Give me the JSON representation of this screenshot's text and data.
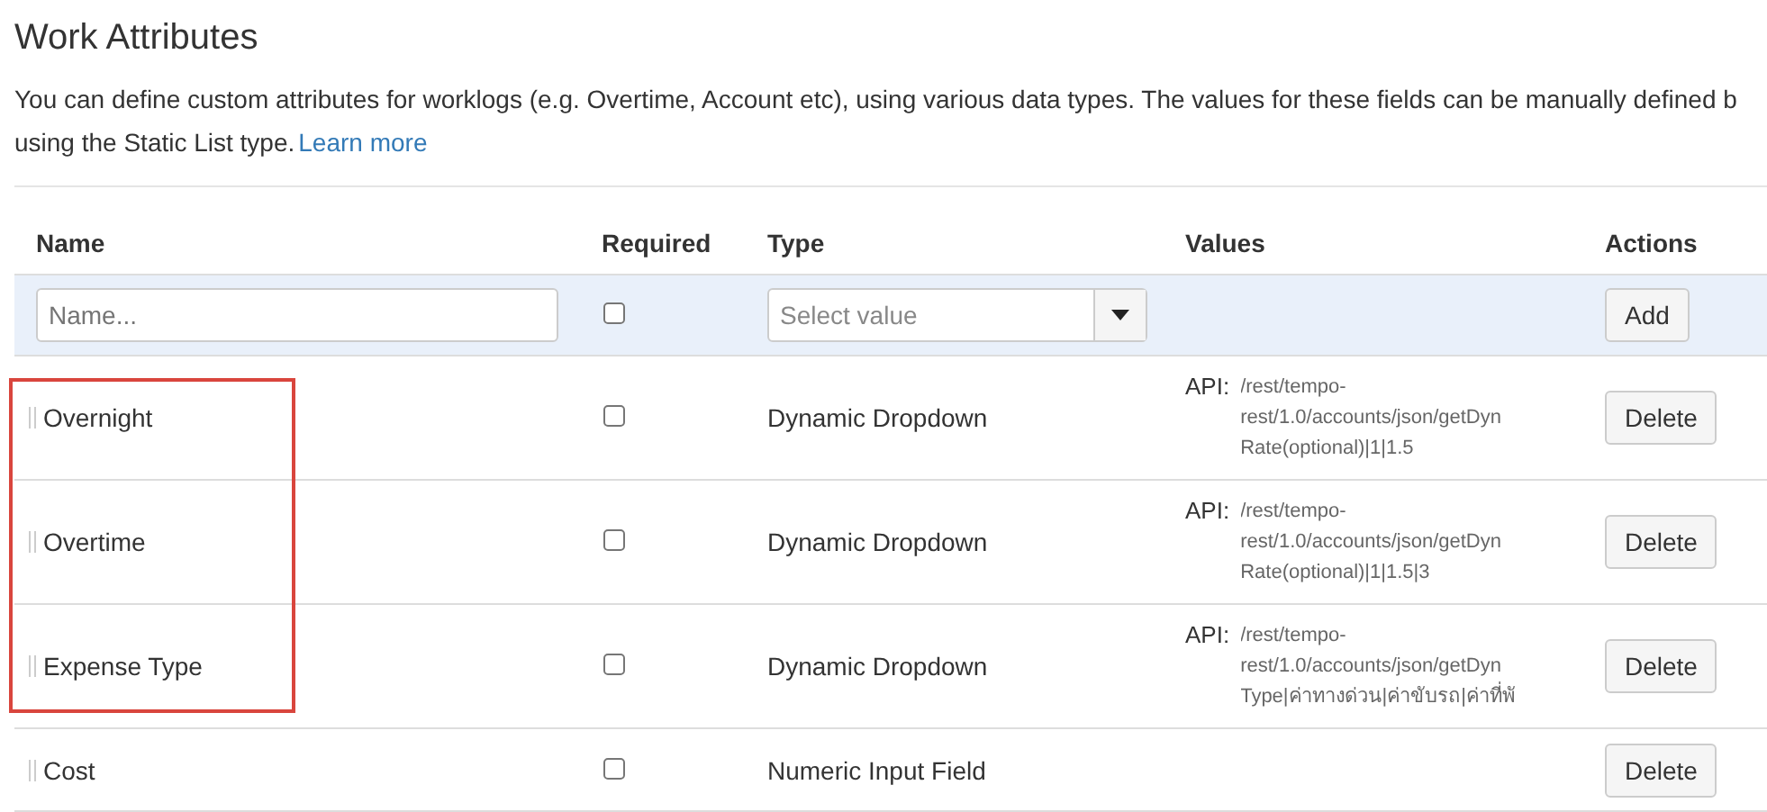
{
  "title": "Work Attributes",
  "description": [
    "You can define custom attributes for worklogs (e.g. Overtime, Account etc), using various data types. The values for these fields can be manually defined b",
    "using the Static List type."
  ],
  "learn_more": "Learn more",
  "columns": [
    "Name",
    "Required",
    "Type",
    "Values",
    "Actions"
  ],
  "new_row": {
    "name_placeholder": "Name...",
    "required_checked": false,
    "type_placeholder": "Select value",
    "button": "Add"
  },
  "rows": [
    {
      "name": "Overnight",
      "required": false,
      "type": "Dynamic Dropdown",
      "values_label": "API:",
      "values": [
        "/rest/tempo-",
        "rest/1.0/accounts/json/getDyn",
        "Rate(optional)|1|1.5"
      ],
      "button": "Delete",
      "highlighted": true
    },
    {
      "name": "Overtime",
      "required": false,
      "type": "Dynamic Dropdown",
      "values_label": "API:",
      "values": [
        "/rest/tempo-",
        "rest/1.0/accounts/json/getDyn",
        "Rate(optional)|1|1.5|3"
      ],
      "button": "Delete",
      "highlighted": true
    },
    {
      "name": "Expense Type",
      "required": false,
      "type": "Dynamic Dropdown",
      "values_label": "API:",
      "values": [
        "/rest/tempo-",
        "rest/1.0/accounts/json/getDyn",
        "Type|ค่าทางด่วน|ค่าขับรถ|ค่าที่พั"
      ],
      "button": "Delete",
      "highlighted": true
    },
    {
      "name": "Cost",
      "required": false,
      "type": "Numeric Input Field",
      "button": "Delete",
      "highlighted": false
    }
  ]
}
